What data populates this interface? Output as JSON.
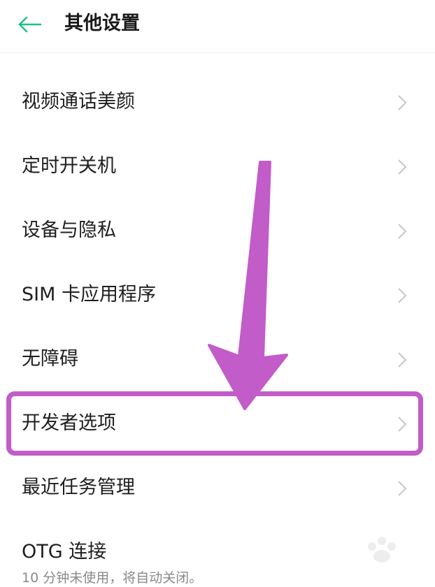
{
  "header": {
    "back_icon": "arrow-left-icon",
    "title": "其他设置"
  },
  "colors": {
    "accent": "#1fbf8a",
    "highlight": "#c25cc9",
    "chevron": "#c7c7c7"
  },
  "settings": {
    "items": [
      {
        "label": "视频通话美颜",
        "icon": "chevron-right-icon"
      },
      {
        "label": "定时开关机",
        "icon": "chevron-right-icon"
      },
      {
        "label": "设备与隐私",
        "icon": "chevron-right-icon"
      },
      {
        "label": "SIM 卡应用程序",
        "icon": "chevron-right-icon"
      },
      {
        "label": "无障碍",
        "icon": "chevron-right-icon"
      },
      {
        "label": "开发者选项",
        "icon": "chevron-right-icon",
        "highlighted": true
      },
      {
        "label": "最近任务管理",
        "icon": "chevron-right-icon"
      },
      {
        "label": "OTG 连接",
        "sublabel": "10 分钟未使用，将自动关闭。"
      }
    ]
  },
  "annotation": {
    "icon": "down-arrow-annotation"
  }
}
